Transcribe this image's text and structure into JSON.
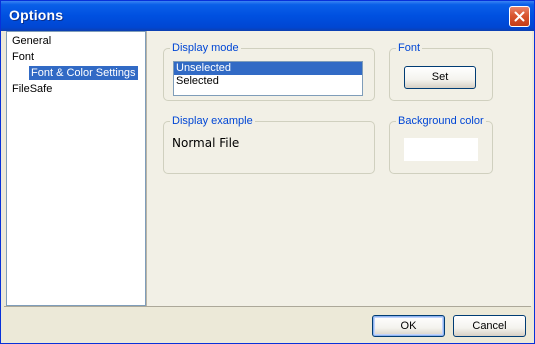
{
  "window": {
    "title": "Options"
  },
  "tree": {
    "items": [
      {
        "label": "General",
        "level": 0,
        "selected": false
      },
      {
        "label": "Font",
        "level": 0,
        "selected": false
      },
      {
        "label": "Font & Color Settings",
        "level": 1,
        "selected": true
      },
      {
        "label": "FileSafe",
        "level": 0,
        "selected": false
      }
    ]
  },
  "display_mode": {
    "legend": "Display mode",
    "options": [
      "Unselected",
      "Selected"
    ],
    "selected": "Unselected"
  },
  "font_group": {
    "legend": "Font",
    "button_label": "Set"
  },
  "display_example": {
    "legend": "Display example",
    "text": "Normal File"
  },
  "background_color": {
    "legend": "Background color",
    "value": "#ffffff"
  },
  "footer": {
    "ok_label": "OK",
    "cancel_label": "Cancel"
  },
  "icons": {
    "close": "close-icon"
  },
  "colors": {
    "title_bar": "#0050e0",
    "selection": "#316ac5",
    "group_legend": "#0046d5",
    "dialog_bg": "#ece9d8"
  }
}
